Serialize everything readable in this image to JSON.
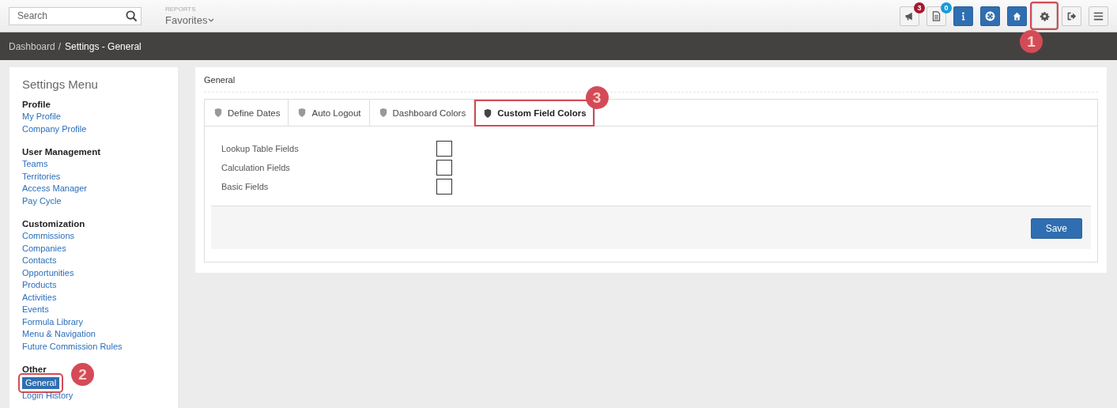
{
  "topbar": {
    "search": {
      "placeholder": "Search"
    },
    "reports_label": "REPORTS",
    "favorites": "Favorites",
    "buttons": [
      {
        "kind": "plain",
        "badge": {
          "text": "3",
          "color": "#a6192e"
        }
      },
      {
        "kind": "plain",
        "badge": {
          "text": "0",
          "color": "#1a9ad6"
        }
      },
      {
        "kind": "primary"
      },
      {
        "kind": "primary"
      },
      {
        "kind": "primary"
      },
      {
        "kind": "plain",
        "callout": "1"
      },
      {
        "kind": "plain"
      },
      {
        "kind": "plain"
      }
    ]
  },
  "breadcrumb": {
    "separator": "/",
    "items": [
      {
        "text": "Dashboard",
        "current": false
      },
      {
        "text": "Settings - General",
        "current": true
      }
    ]
  },
  "sidebar": {
    "title": "Settings Menu",
    "groups": [
      {
        "heading": "Profile",
        "items": [
          {
            "label": "My Profile",
            "selected": false
          },
          {
            "label": "Company Profile",
            "selected": false
          }
        ]
      },
      {
        "heading": "User Management",
        "items": [
          {
            "label": "Teams",
            "selected": false
          },
          {
            "label": "Territories",
            "selected": false
          },
          {
            "label": "Access Manager",
            "selected": false
          },
          {
            "label": "Pay Cycle",
            "selected": false
          }
        ]
      },
      {
        "heading": "Customization",
        "items": [
          {
            "label": "Commissions",
            "selected": false
          },
          {
            "label": "Companies",
            "selected": false
          },
          {
            "label": "Contacts",
            "selected": false
          },
          {
            "label": "Opportunities",
            "selected": false
          },
          {
            "label": "Products",
            "selected": false
          },
          {
            "label": "Activities",
            "selected": false
          },
          {
            "label": "Events",
            "selected": false
          },
          {
            "label": "Formula Library",
            "selected": false
          },
          {
            "label": "Menu & Navigation",
            "selected": false
          },
          {
            "label": "Future Commission Rules",
            "selected": false
          }
        ]
      },
      {
        "heading": "Other",
        "items": [
          {
            "label": "General",
            "selected": true,
            "callout": "2"
          },
          {
            "label": "Login History",
            "selected": false
          }
        ]
      }
    ]
  },
  "panel": {
    "title": "General",
    "tabs": [
      {
        "label": "Define Dates",
        "selected": false
      },
      {
        "label": "Auto Logout",
        "selected": false
      },
      {
        "label": "Dashboard Colors",
        "selected": false
      },
      {
        "label": "Custom Field Colors",
        "selected": true,
        "callout": "3"
      }
    ],
    "fields": [
      {
        "label": "Lookup Table Fields",
        "checked": false
      },
      {
        "label": "Calculation Fields",
        "checked": false
      },
      {
        "label": "Basic Fields",
        "checked": false
      }
    ],
    "save_button": "Save"
  }
}
